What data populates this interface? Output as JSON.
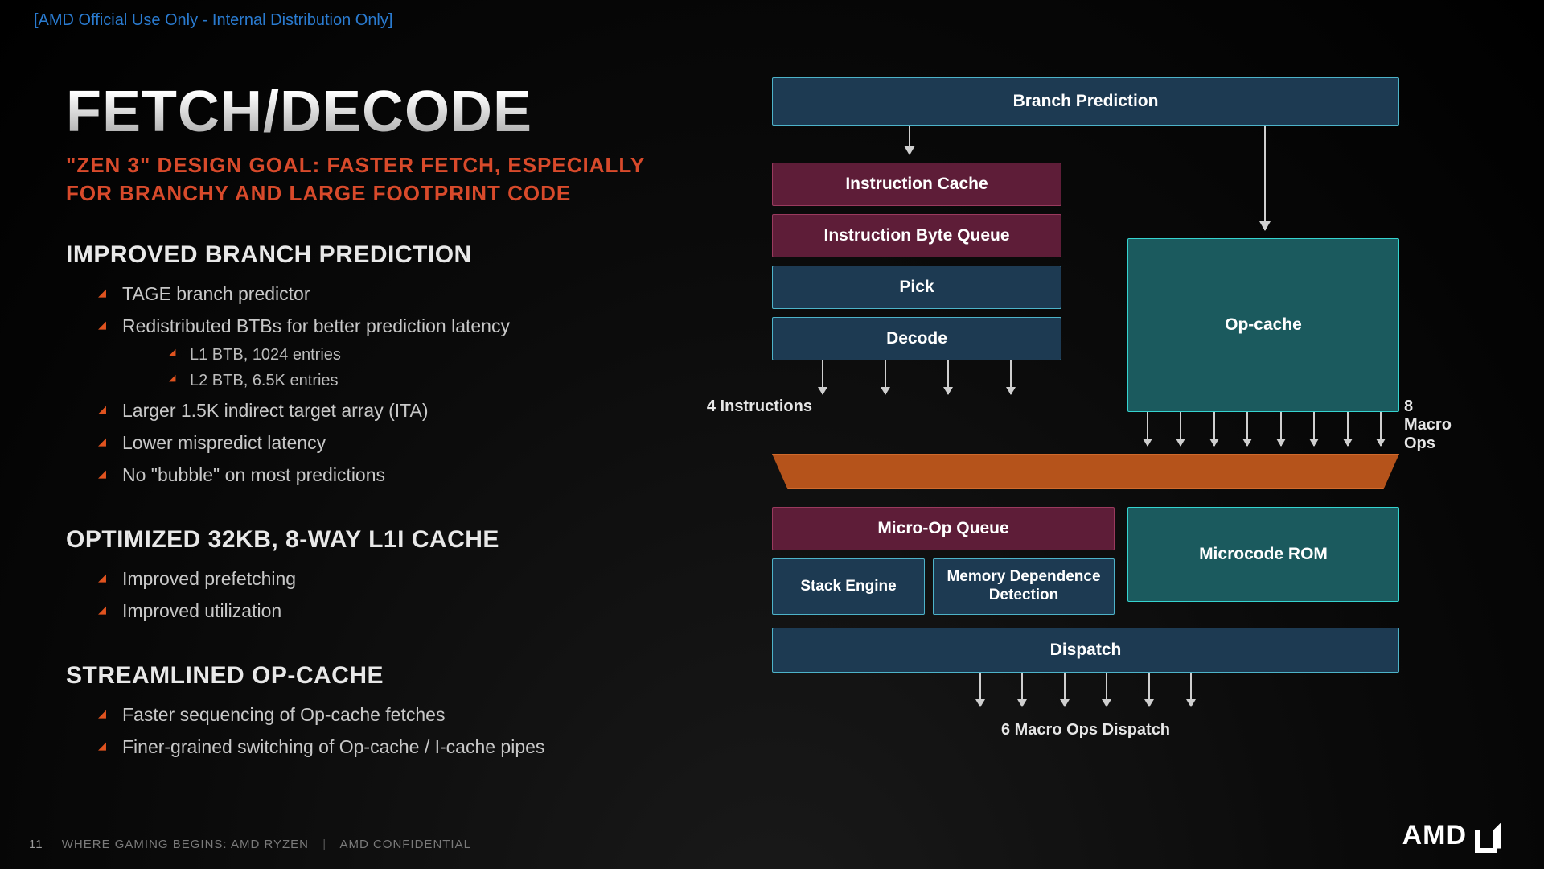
{
  "banner": "[AMD Official Use Only - Internal Distribution Only]",
  "title": "FETCH/DECODE",
  "subtitle_line1": "\"ZEN 3\" DESIGN GOAL: FASTER FETCH, ESPECIALLY",
  "subtitle_line2": "FOR BRANCHY AND LARGE FOOTPRINT CODE",
  "sections": {
    "a": {
      "head": "IMPROVED BRANCH PREDICTION",
      "items": {
        "i0": "TAGE branch predictor",
        "i1": "Redistributed BTBs for better prediction latency",
        "i1a": "L1 BTB, 1024 entries",
        "i1b": "L2 BTB, 6.5K entries",
        "i2": "Larger 1.5K indirect target array (ITA)",
        "i3": "Lower mispredict latency",
        "i4": "No \"bubble\" on most predictions"
      }
    },
    "b": {
      "head": "OPTIMIZED 32KB, 8-WAY L1I CACHE",
      "items": {
        "i0": "Improved prefetching",
        "i1": "Improved utilization"
      }
    },
    "c": {
      "head": "STREAMLINED OP-CACHE",
      "items": {
        "i0": "Faster sequencing of Op-cache fetches",
        "i1": "Finer-grained switching of Op-cache / I-cache pipes"
      }
    }
  },
  "diagram": {
    "branch_prediction": "Branch Prediction",
    "instruction_cache": "Instruction Cache",
    "ibq": "Instruction Byte Queue",
    "pick": "Pick",
    "decode": "Decode",
    "op_cache": "Op-cache",
    "four_instr": "4 Instructions",
    "eight_macro": "8 Macro Ops",
    "micro_op_queue": "Micro-Op Queue",
    "stack_engine": "Stack Engine",
    "mem_dep": "Memory Dependence Detection",
    "microcode_rom": "Microcode ROM",
    "dispatch": "Dispatch",
    "six_macro_dispatch": "6 Macro Ops Dispatch"
  },
  "logo_text": "AMD",
  "footer": {
    "page": "11",
    "text_a": "WHERE GAMING BEGINS:  AMD RYZEN",
    "text_b": "AMD CONFIDENTIAL"
  }
}
